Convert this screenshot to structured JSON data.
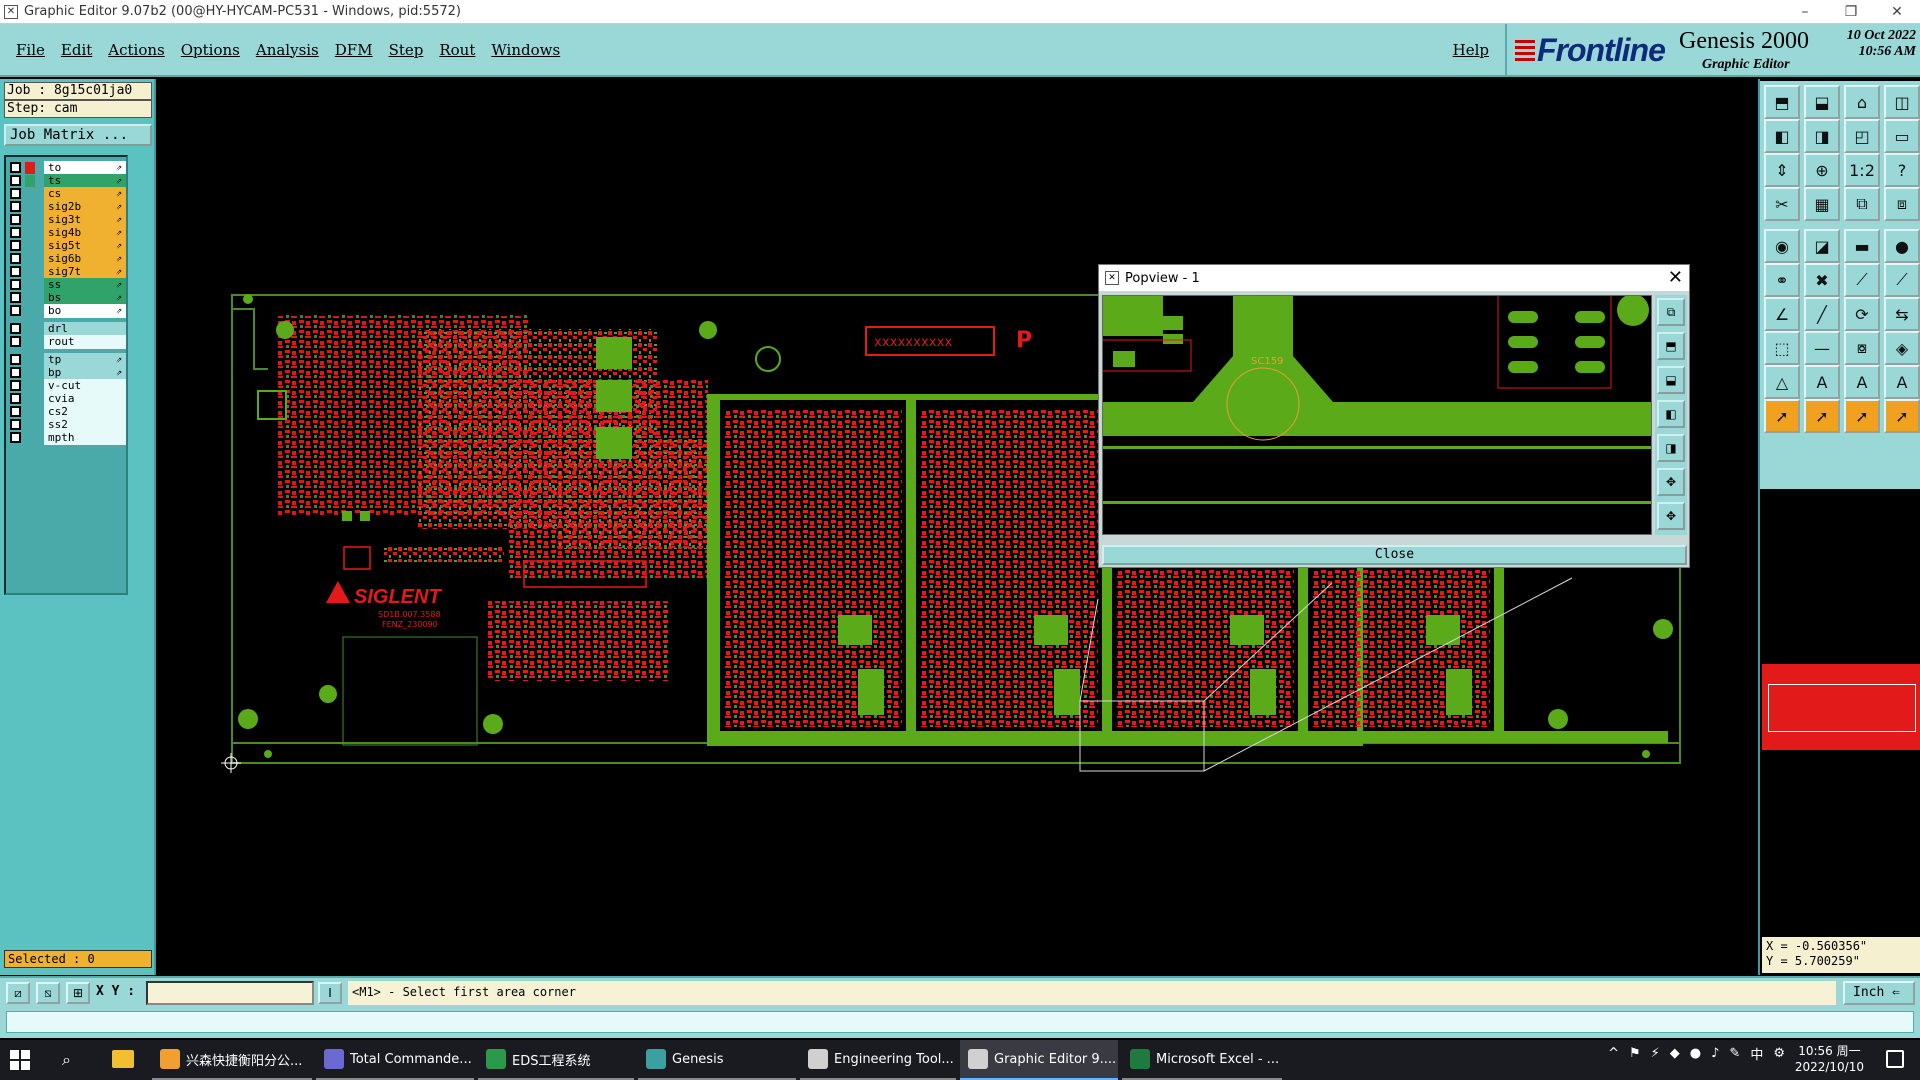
{
  "window": {
    "title": "Graphic Editor 9.07b2 (00@HY-HYCAM-PC531 - Windows, pid:5572)",
    "icon_glyph": "✕",
    "controls": [
      "–",
      "❐",
      "✕"
    ]
  },
  "menu": {
    "items": [
      "File",
      "Edit",
      "Actions",
      "Options",
      "Analysis",
      "DFM",
      "Step",
      "Rout",
      "Windows"
    ],
    "help": "Help"
  },
  "brand": {
    "logo": "Frontline",
    "product": "Genesis 2000",
    "subtitle": "Graphic Editor",
    "date": "10 Oct 2022",
    "time": "10:56 AM"
  },
  "left": {
    "job": "Job : 8g15c01ja0",
    "step": "Step: cam",
    "job_matrix": "Job Matrix ...",
    "layers": [
      {
        "name": "to",
        "bg": "#ffffff",
        "swatch": "#e21a1a",
        "arrow": "⇗"
      },
      {
        "name": "ts",
        "bg": "#2fa36a",
        "swatch": "#2fa36a",
        "arrow": "⇗"
      },
      {
        "name": "cs",
        "bg": "#f0b030",
        "swatch": "",
        "arrow": "⇗"
      },
      {
        "name": "sig2b",
        "bg": "#f0b030",
        "swatch": "",
        "arrow": "⇗"
      },
      {
        "name": "sig3t",
        "bg": "#f0b030",
        "swatch": "",
        "arrow": "⇗"
      },
      {
        "name": "sig4b",
        "bg": "#f0b030",
        "swatch": "",
        "arrow": "⇗"
      },
      {
        "name": "sig5t",
        "bg": "#f0b030",
        "swatch": "",
        "arrow": "⇗"
      },
      {
        "name": "sig6b",
        "bg": "#f0b030",
        "swatch": "",
        "arrow": "⇗"
      },
      {
        "name": "sig7t",
        "bg": "#f0b030",
        "swatch": "",
        "arrow": "⇗"
      },
      {
        "name": "ss",
        "bg": "#2fa36a",
        "swatch": "",
        "arrow": "⇗"
      },
      {
        "name": "bs",
        "bg": "#2fa36a",
        "swatch": "",
        "arrow": "⇗"
      },
      {
        "name": "bo",
        "bg": "#ffffff",
        "swatch": "",
        "arrow": "⇗"
      },
      {
        "name": "drl",
        "bg": "#9ad7d7",
        "swatch": "",
        "arrow": ""
      },
      {
        "name": "rout",
        "bg": "#e6fafa",
        "swatch": "",
        "arrow": ""
      },
      {
        "name": "tp",
        "bg": "#9ad7d7",
        "swatch": "",
        "arrow": "⇗"
      },
      {
        "name": "bp",
        "bg": "#9ad7d7",
        "swatch": "",
        "arrow": "⇗"
      },
      {
        "name": "v-cut",
        "bg": "#e6fafa",
        "swatch": "",
        "arrow": ""
      },
      {
        "name": "cvia",
        "bg": "#e6fafa",
        "swatch": "",
        "arrow": ""
      },
      {
        "name": "cs2",
        "bg": "#e6fafa",
        "swatch": "",
        "arrow": ""
      },
      {
        "name": "ss2",
        "bg": "#e6fafa",
        "swatch": "",
        "arrow": ""
      },
      {
        "name": "mpth",
        "bg": "#e6fafa",
        "swatch": "",
        "arrow": ""
      }
    ],
    "selected": "Selected : 0"
  },
  "board": {
    "brand_text": "SIGLENT",
    "part_text": "SD1B.007.3588",
    "part_text2": "FENZ_230090",
    "connector_text": "xxxxxxxxxx"
  },
  "popview": {
    "title": "Popview - 1",
    "close_label": "Close",
    "close_glyph": "✕",
    "component_label": "SC159",
    "tool_glyphs": [
      "⧉",
      "⬒",
      "⬓",
      "◧",
      "◨",
      "✥",
      "✥"
    ]
  },
  "tools": [
    "⬒",
    "⬓",
    "⌂",
    "◫",
    "◧",
    "◨",
    "◰",
    "▭",
    "⇕",
    "⊕",
    "1:2",
    "?",
    "✂",
    "▦",
    "⧉",
    "⧈",
    "◉",
    "◪",
    "▬",
    "●",
    "⚭",
    "✖",
    "⟋",
    "⟋",
    "∠",
    "╱",
    "⟳",
    "⇆",
    "⬚",
    "—",
    "⧇",
    "◈",
    "△",
    "A",
    "A",
    "A",
    "➚",
    "➚",
    "➚",
    "➚"
  ],
  "coords": {
    "x": "X = -0.560356\"",
    "y": "Y =  5.700259\""
  },
  "cmd": {
    "xy_label": "X Y :",
    "xy_value": "",
    "prompt": "<M1> - Select first area corner",
    "unit": "Inch ⇐",
    "tool_glyphs": [
      "⧄",
      "⧅",
      "⊞",
      "Ⅰ"
    ]
  },
  "taskbar": {
    "tasks": [
      {
        "label": "兴森快捷衡阳分公...",
        "color": "#f0a030",
        "state": "open"
      },
      {
        "label": "Total Commande...",
        "color": "#6a6ad0",
        "state": "open"
      },
      {
        "label": "EDS工程系统",
        "color": "#2a9a4a",
        "state": "open"
      },
      {
        "label": "Genesis",
        "color": "#3aa0a0",
        "state": "open"
      },
      {
        "label": "Engineering Tool...",
        "color": "#d0d0d0",
        "state": "open"
      },
      {
        "label": "Graphic Editor 9....",
        "color": "#d0d0d0",
        "state": "active"
      },
      {
        "label": "Microsoft Excel - ...",
        "color": "#1f7a3f",
        "state": "open"
      }
    ],
    "tray_icons": [
      "^",
      "⚑",
      "⚡",
      "◆",
      "●",
      "♪",
      "✎",
      "中",
      "⚙"
    ],
    "clock_time": "10:56 周一",
    "clock_date": "2022/10/10"
  }
}
